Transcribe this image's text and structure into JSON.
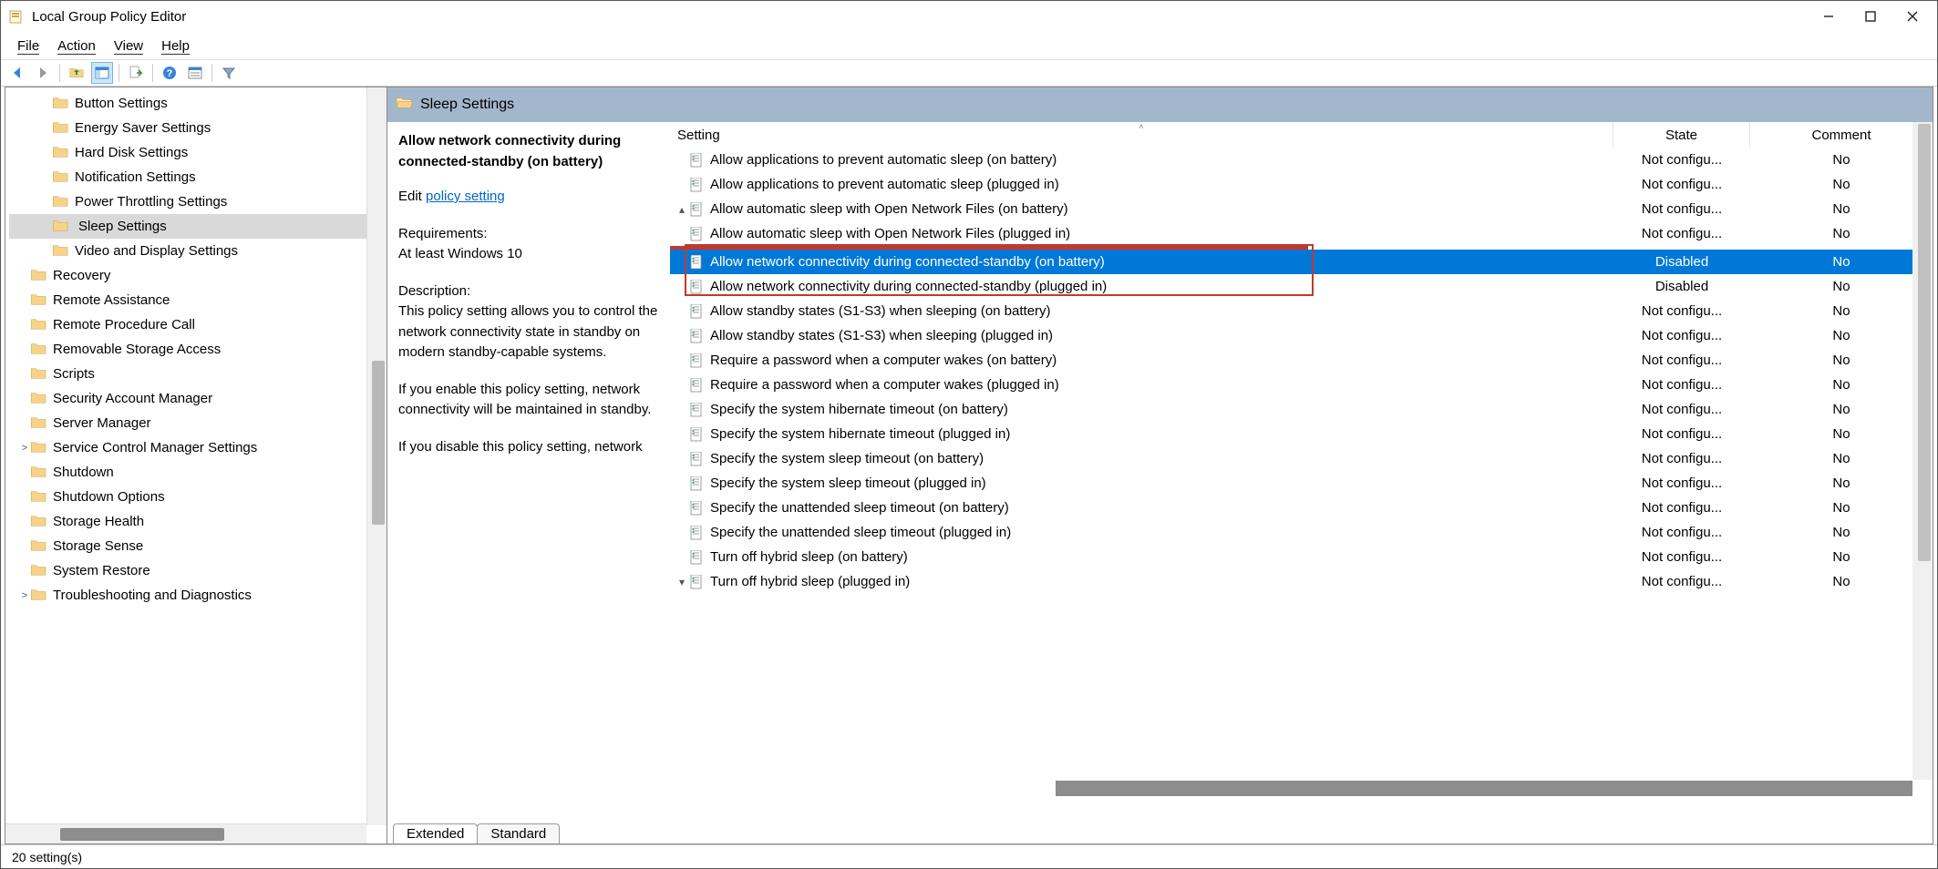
{
  "window": {
    "title": "Local Group Policy Editor"
  },
  "menu": {
    "file": "File",
    "action": "Action",
    "view": "View",
    "help": "Help"
  },
  "tree": {
    "items": [
      {
        "label": "Button Settings",
        "indent": 2,
        "expand": ""
      },
      {
        "label": "Energy Saver Settings",
        "indent": 2,
        "expand": ""
      },
      {
        "label": "Hard Disk Settings",
        "indent": 2,
        "expand": ""
      },
      {
        "label": "Notification Settings",
        "indent": 2,
        "expand": ""
      },
      {
        "label": "Power Throttling Settings",
        "indent": 2,
        "expand": ""
      },
      {
        "label": "Sleep Settings",
        "indent": 2,
        "expand": "",
        "selected": true
      },
      {
        "label": "Video and Display Settings",
        "indent": 2,
        "expand": ""
      },
      {
        "label": "Recovery",
        "indent": 1,
        "expand": ""
      },
      {
        "label": "Remote Assistance",
        "indent": 1,
        "expand": ""
      },
      {
        "label": "Remote Procedure Call",
        "indent": 1,
        "expand": ""
      },
      {
        "label": "Removable Storage Access",
        "indent": 1,
        "expand": ""
      },
      {
        "label": "Scripts",
        "indent": 1,
        "expand": ""
      },
      {
        "label": "Security Account Manager",
        "indent": 1,
        "expand": ""
      },
      {
        "label": "Server Manager",
        "indent": 1,
        "expand": ""
      },
      {
        "label": "Service Control Manager Settings",
        "indent": 1,
        "expand": ">"
      },
      {
        "label": "Shutdown",
        "indent": 1,
        "expand": ""
      },
      {
        "label": "Shutdown Options",
        "indent": 1,
        "expand": ""
      },
      {
        "label": "Storage Health",
        "indent": 1,
        "expand": ""
      },
      {
        "label": "Storage Sense",
        "indent": 1,
        "expand": ""
      },
      {
        "label": "System Restore",
        "indent": 1,
        "expand": ""
      },
      {
        "label": "Troubleshooting and Diagnostics",
        "indent": 1,
        "expand": ">"
      }
    ]
  },
  "details": {
    "header": "Sleep Settings",
    "selected_title": "Allow network connectivity during connected-standby (on battery)",
    "edit_prefix": "Edit",
    "edit_link": "policy setting",
    "req_label": "Requirements:",
    "req_value": "At least Windows 10",
    "desc_label": "Description:",
    "desc_p1": "This policy setting allows you to control the network connectivity state in standby on modern standby-capable systems.",
    "desc_p2": "If you enable this policy setting, network connectivity will be maintained in standby.",
    "desc_p3": "If you disable this policy setting, network",
    "columns": {
      "setting": "Setting",
      "state": "State",
      "comment": "Comment"
    },
    "rows": [
      {
        "setting": "Allow applications to prevent automatic sleep (on battery)",
        "state": "Not configu...",
        "comment": "No",
        "arrow": ""
      },
      {
        "setting": "Allow applications to prevent automatic sleep (plugged in)",
        "state": "Not configu...",
        "comment": "No",
        "arrow": ""
      },
      {
        "setting": "Allow automatic sleep with Open Network Files (on battery)",
        "state": "Not configu...",
        "comment": "No",
        "arrow": "▴"
      },
      {
        "setting": "Allow automatic sleep with Open Network Files (plugged in)",
        "state": "Not configu...",
        "comment": "No",
        "arrow": ""
      },
      {
        "setting": "Allow network connectivity during connected-standby (on battery)",
        "state": "Disabled",
        "comment": "No",
        "arrow": "",
        "selected": true,
        "boxed": true
      },
      {
        "setting": "Allow network connectivity during connected-standby (plugged in)",
        "state": "Disabled",
        "comment": "No",
        "arrow": "",
        "boxed": true
      },
      {
        "setting": "Allow standby states (S1-S3) when sleeping (on battery)",
        "state": "Not configu...",
        "comment": "No",
        "arrow": ""
      },
      {
        "setting": "Allow standby states (S1-S3) when sleeping (plugged in)",
        "state": "Not configu...",
        "comment": "No",
        "arrow": ""
      },
      {
        "setting": "Require a password when a computer wakes (on battery)",
        "state": "Not configu...",
        "comment": "No",
        "arrow": ""
      },
      {
        "setting": "Require a password when a computer wakes (plugged in)",
        "state": "Not configu...",
        "comment": "No",
        "arrow": ""
      },
      {
        "setting": "Specify the system hibernate timeout (on battery)",
        "state": "Not configu...",
        "comment": "No",
        "arrow": ""
      },
      {
        "setting": "Specify the system hibernate timeout (plugged in)",
        "state": "Not configu...",
        "comment": "No",
        "arrow": ""
      },
      {
        "setting": "Specify the system sleep timeout (on battery)",
        "state": "Not configu...",
        "comment": "No",
        "arrow": ""
      },
      {
        "setting": "Specify the system sleep timeout (plugged in)",
        "state": "Not configu...",
        "comment": "No",
        "arrow": ""
      },
      {
        "setting": "Specify the unattended sleep timeout (on battery)",
        "state": "Not configu...",
        "comment": "No",
        "arrow": ""
      },
      {
        "setting": "Specify the unattended sleep timeout (plugged in)",
        "state": "Not configu...",
        "comment": "No",
        "arrow": ""
      },
      {
        "setting": "Turn off hybrid sleep (on battery)",
        "state": "Not configu...",
        "comment": "No",
        "arrow": ""
      },
      {
        "setting": "Turn off hybrid sleep (plugged in)",
        "state": "Not configu...",
        "comment": "No",
        "arrow": "▾"
      }
    ],
    "tabs": {
      "extended": "Extended",
      "standard": "Standard"
    }
  },
  "status": {
    "text": "20 setting(s)"
  }
}
